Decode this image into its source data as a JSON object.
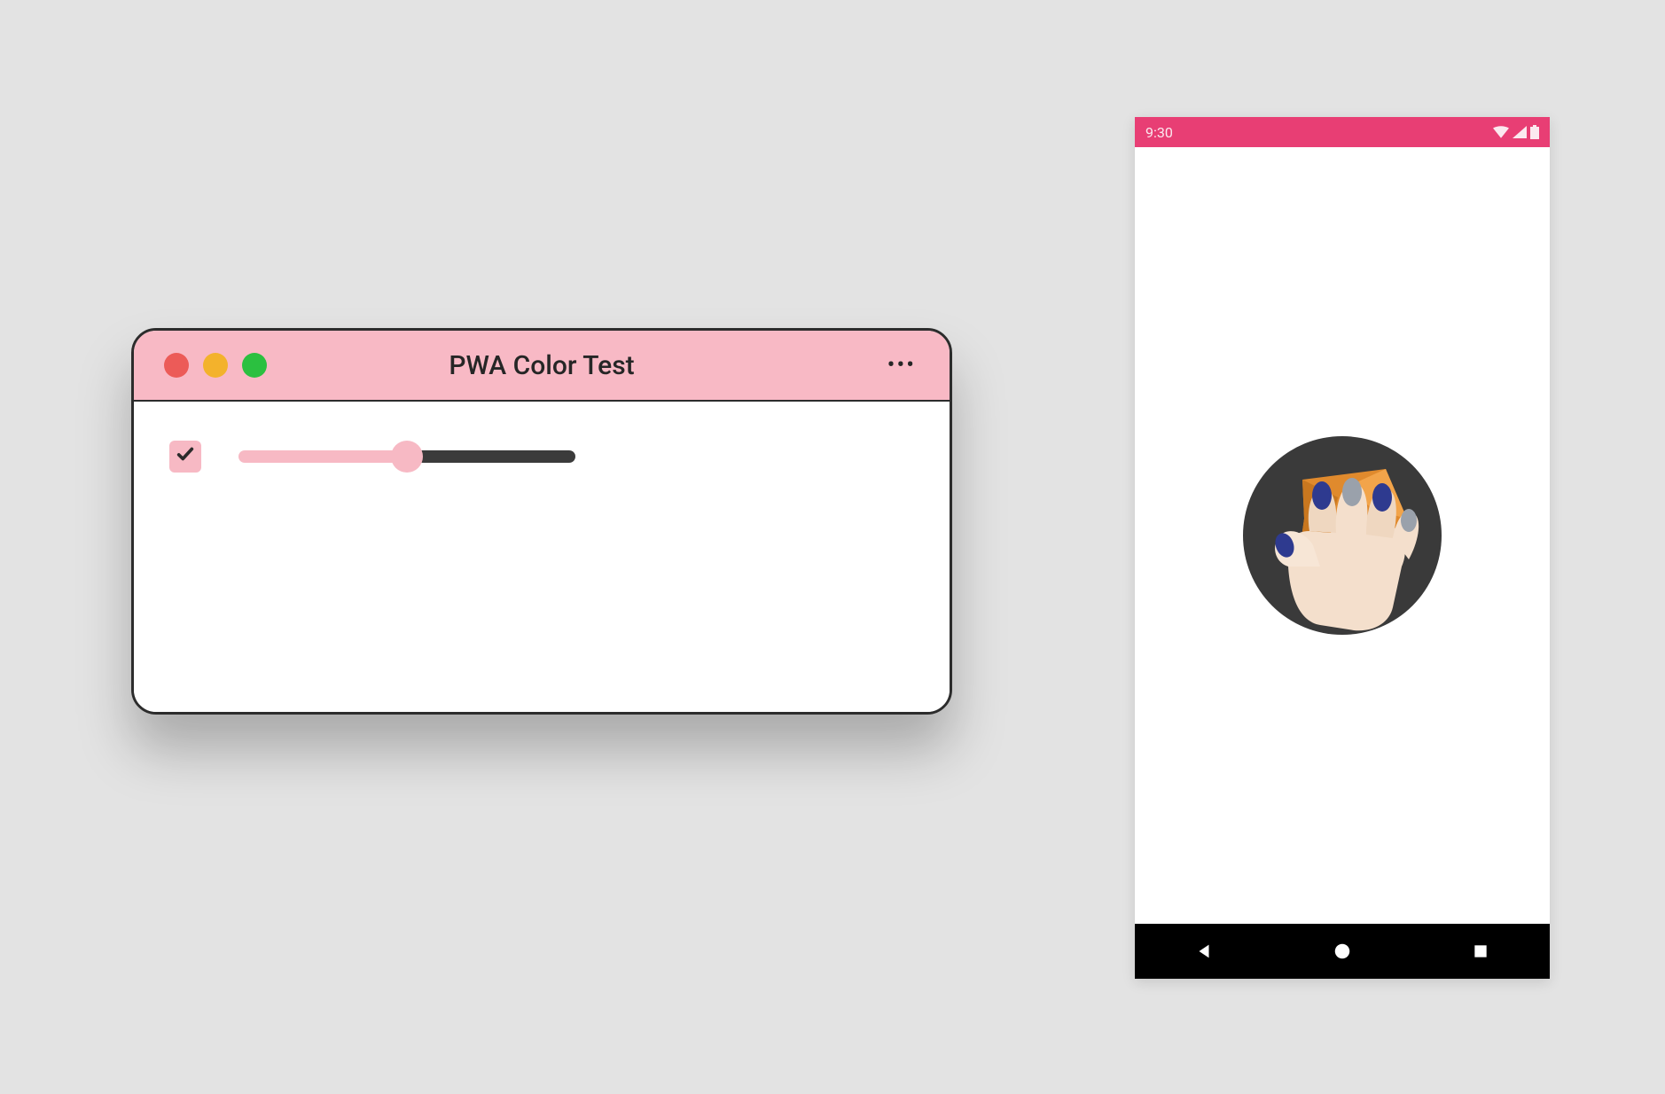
{
  "colors": {
    "titlebar_bg": "#f8b9c5",
    "accent_pink": "#f7b9c4",
    "status_bar_bg": "#e83e74",
    "traffic_close": "#ec5b58",
    "traffic_minimize": "#f3b22c",
    "traffic_maximize": "#2bc040",
    "nav_bar_bg": "#000000"
  },
  "mac_window": {
    "title": "PWA Color Test",
    "menu_glyph": "•••",
    "checkbox": {
      "checked": true
    },
    "slider": {
      "percent": 50
    }
  },
  "phone": {
    "status_bar": {
      "time": "9:30",
      "icons": {
        "wifi": "wifi-icon",
        "signal": "signal-icon",
        "battery": "battery-icon"
      }
    },
    "splash": {
      "icon_name": "squoosh-app-icon"
    },
    "nav": {
      "back": "triangle-back-icon",
      "home": "circle-home-icon",
      "recent": "square-recent-icon"
    }
  }
}
